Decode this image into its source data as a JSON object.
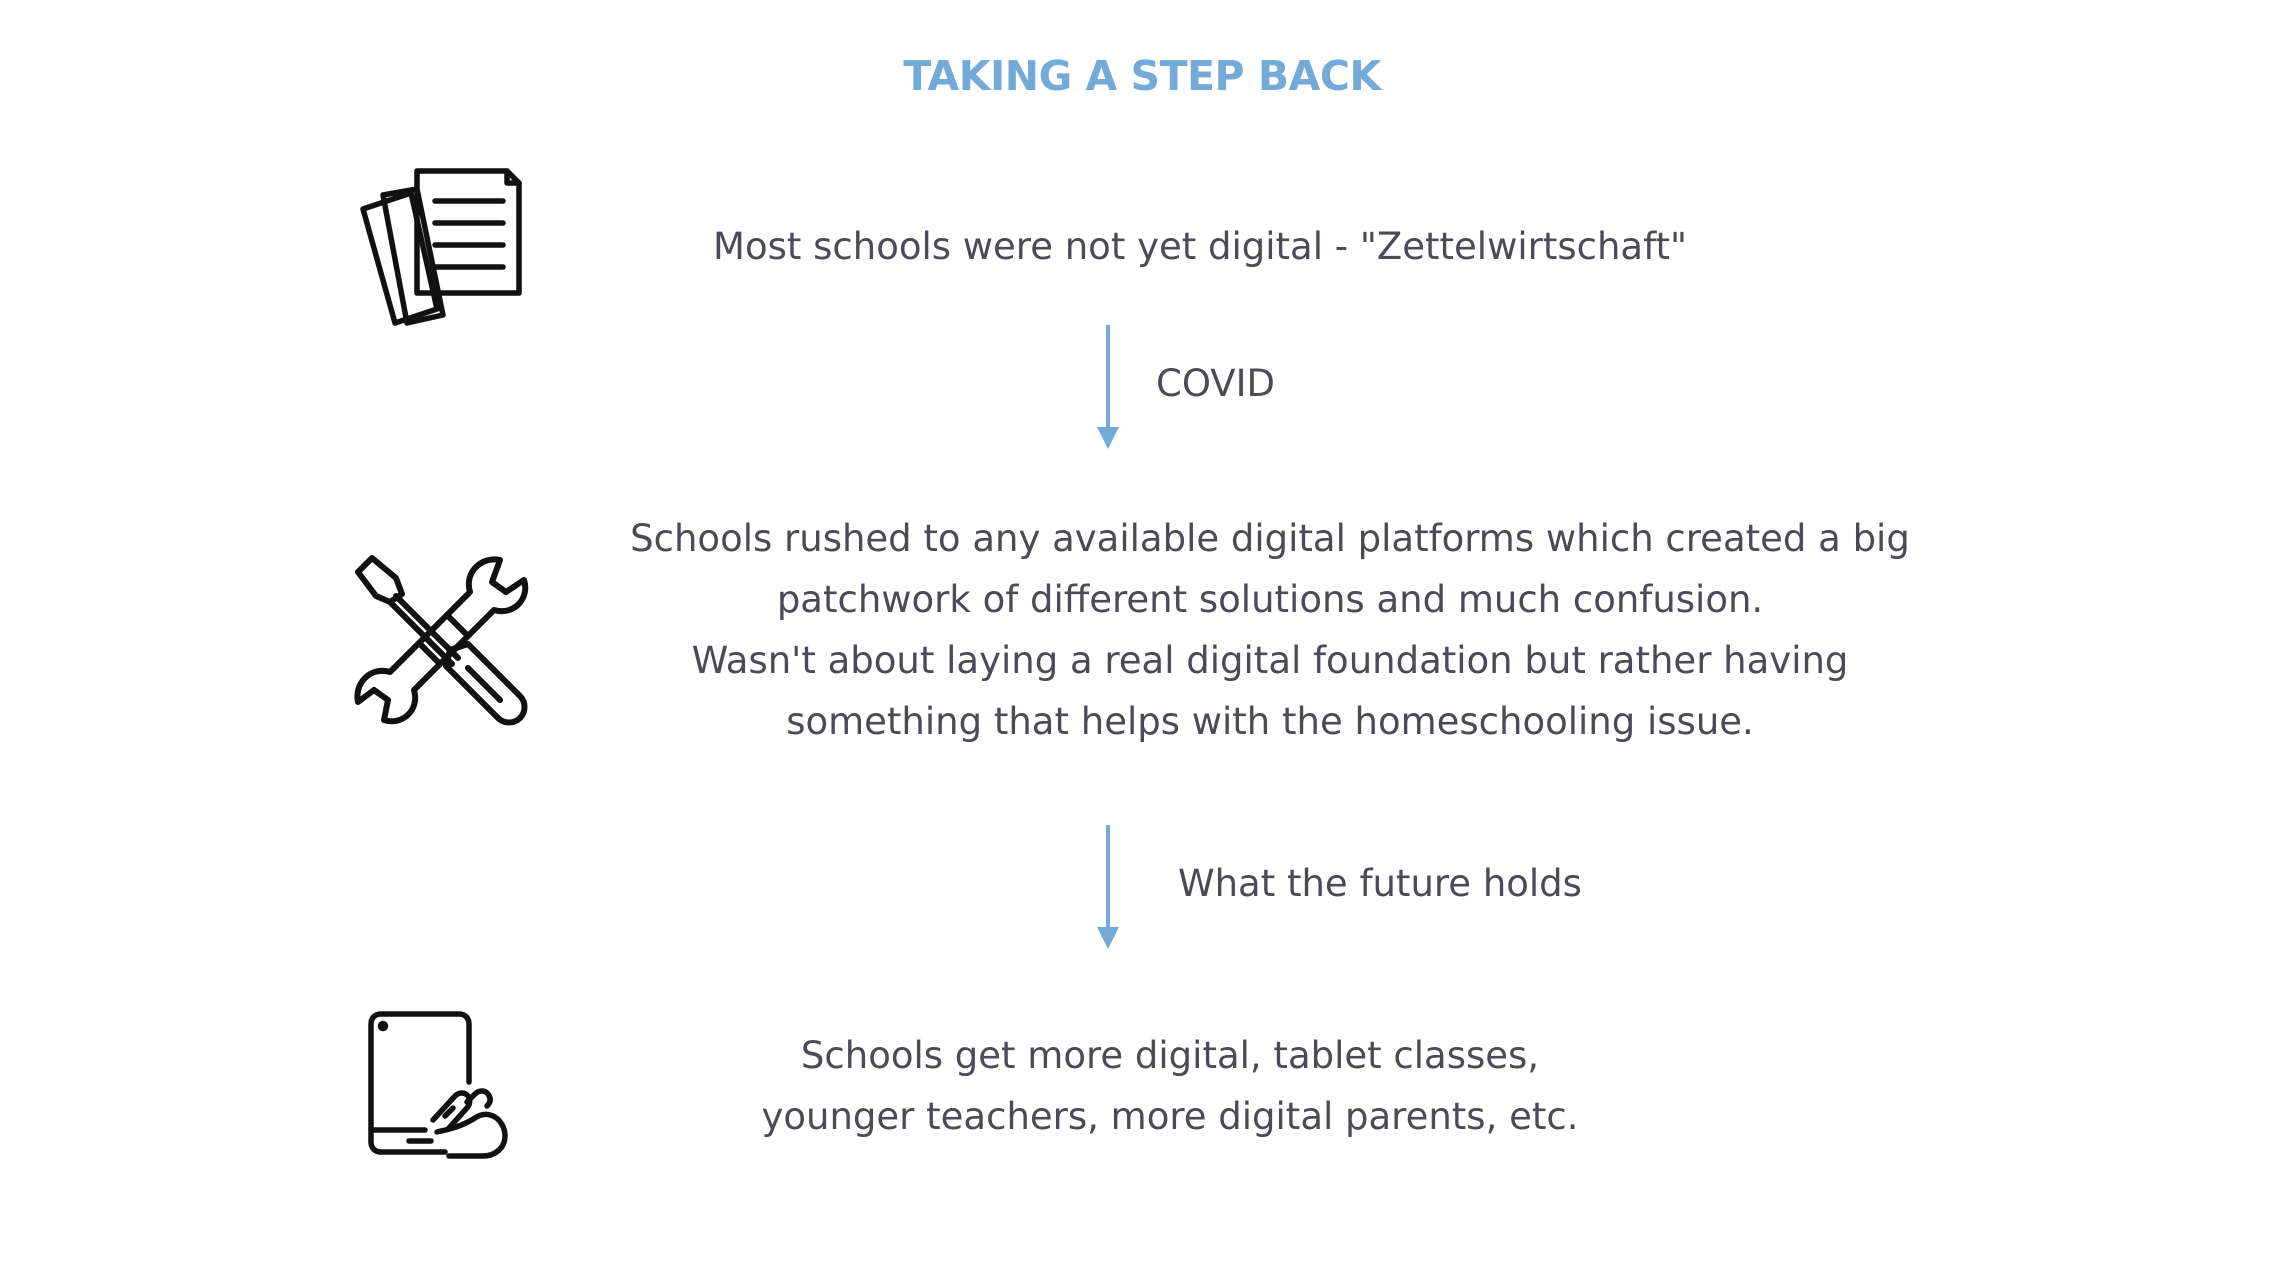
{
  "title": "TAKING A STEP BACK",
  "accent_color": "#74aad8",
  "text_color": "#4b4b57",
  "steps": [
    {
      "icon": "papers-icon",
      "lines": [
        "Most schools were not yet digital - \"Zettelwirtschaft\""
      ]
    },
    {
      "icon": "tools-icon",
      "lines": [
        "Schools rushed to any available digital platforms which created a big",
        "patchwork of different solutions and much confusion.",
        "Wasn't about laying a real digital foundation but rather having",
        "something that helps with the homeschooling issue."
      ]
    },
    {
      "icon": "tablet-touch-icon",
      "lines": [
        "Schools get more digital, tablet classes,",
        "younger teachers, more digital parents, etc."
      ]
    }
  ],
  "transitions": [
    {
      "label": "COVID"
    },
    {
      "label": "What the future holds"
    }
  ]
}
